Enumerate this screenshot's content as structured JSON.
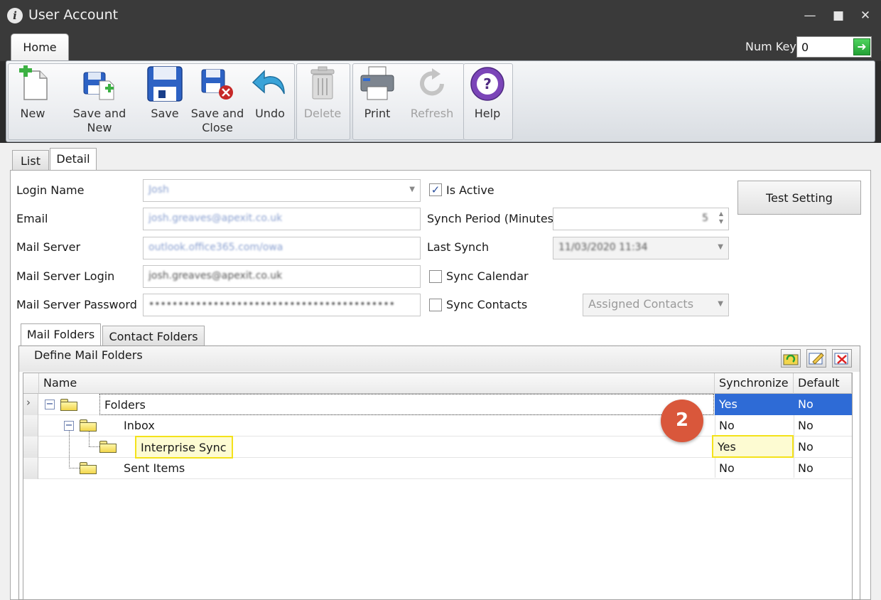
{
  "window": {
    "title": "User Account",
    "app_icon": "info-icon"
  },
  "ribbon": {
    "tab_home": "Home",
    "numkey_label": "Num Key",
    "numkey_value": "0",
    "buttons": {
      "new": "New",
      "save_and_new": "Save and New",
      "save": "Save",
      "save_and_close_1": "Save and",
      "save_and_close_2": "Close",
      "undo": "Undo",
      "delete": "Delete",
      "print": "Print",
      "refresh": "Refresh",
      "help": "Help"
    }
  },
  "tabs": {
    "list": "List",
    "detail": "Detail"
  },
  "form": {
    "login_name_label": "Login Name",
    "login_name_value": "Josh",
    "email_label": "Email",
    "email_value": "josh.greaves@apexit.co.uk",
    "mail_server_label": "Mail Server",
    "mail_server_value": "outlook.office365.com/owa",
    "mail_server_login_label": "Mail Server Login",
    "mail_server_login_value": "josh.greaves@apexit.co.uk",
    "mail_server_password_label": "Mail Server Password",
    "mail_server_password_value": "••••••••••••••••••••••••••••••••••••••••••",
    "is_active_label": "Is Active",
    "is_active_checked": "✓",
    "synch_period_label": "Synch Period (Minutes)",
    "synch_period_value": "5",
    "last_synch_label": "Last Synch",
    "last_synch_value": "11/03/2020 11:34",
    "sync_calendar_label": "Sync Calendar",
    "sync_contacts_label": "Sync Contacts",
    "assigned_contacts": "Assigned Contacts",
    "test_setting_button": "Test Setting"
  },
  "folder_tabs": {
    "mail_folders": "Mail Folders",
    "contact_folders": "Contact Folders"
  },
  "grid": {
    "title": "Define Mail Folders",
    "columns": {
      "name": "Name",
      "synchronize": "Synchronize",
      "default": "Default"
    },
    "rows": [
      {
        "name": "Folders",
        "synchronize": "Yes",
        "default": "No"
      },
      {
        "name": "Inbox",
        "synchronize": "No",
        "default": "No"
      },
      {
        "name": "Interprise Sync",
        "synchronize": "Yes",
        "default": "No"
      },
      {
        "name": "Sent Items",
        "synchronize": "No",
        "default": "No"
      }
    ]
  },
  "annotation": {
    "step_number": "2"
  },
  "colors": {
    "selection": "#2e6bd6",
    "highlight": "#f4e21a",
    "badge": "#d9573b"
  }
}
